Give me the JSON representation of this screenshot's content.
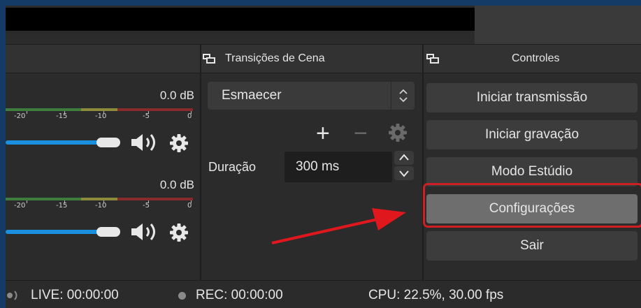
{
  "docks": {
    "transitions_title": "Transições de Cena",
    "controls_title": "Controles"
  },
  "mixer": {
    "channels": [
      {
        "level": "0.0 dB"
      },
      {
        "level": "0.0 dB"
      }
    ],
    "tick_labels": [
      "-20",
      "-15",
      "-10",
      "-5",
      "0"
    ]
  },
  "transitions": {
    "selected": "Esmaecer",
    "duration_label": "Duração",
    "duration_value": "300 ms"
  },
  "controls": {
    "buttons": [
      "Iniciar transmissão",
      "Iniciar gravação",
      "Modo Estúdio",
      "Configurações",
      "Sair"
    ]
  },
  "status": {
    "live": "LIVE: 00:00:00",
    "rec": "REC: 00:00:00",
    "cpu": "CPU: 22.5%, 30.00 fps"
  },
  "colors": {
    "highlight": "#cf1f24",
    "arrow": "#e0181e",
    "volume_slider": "#1a8fe0"
  }
}
